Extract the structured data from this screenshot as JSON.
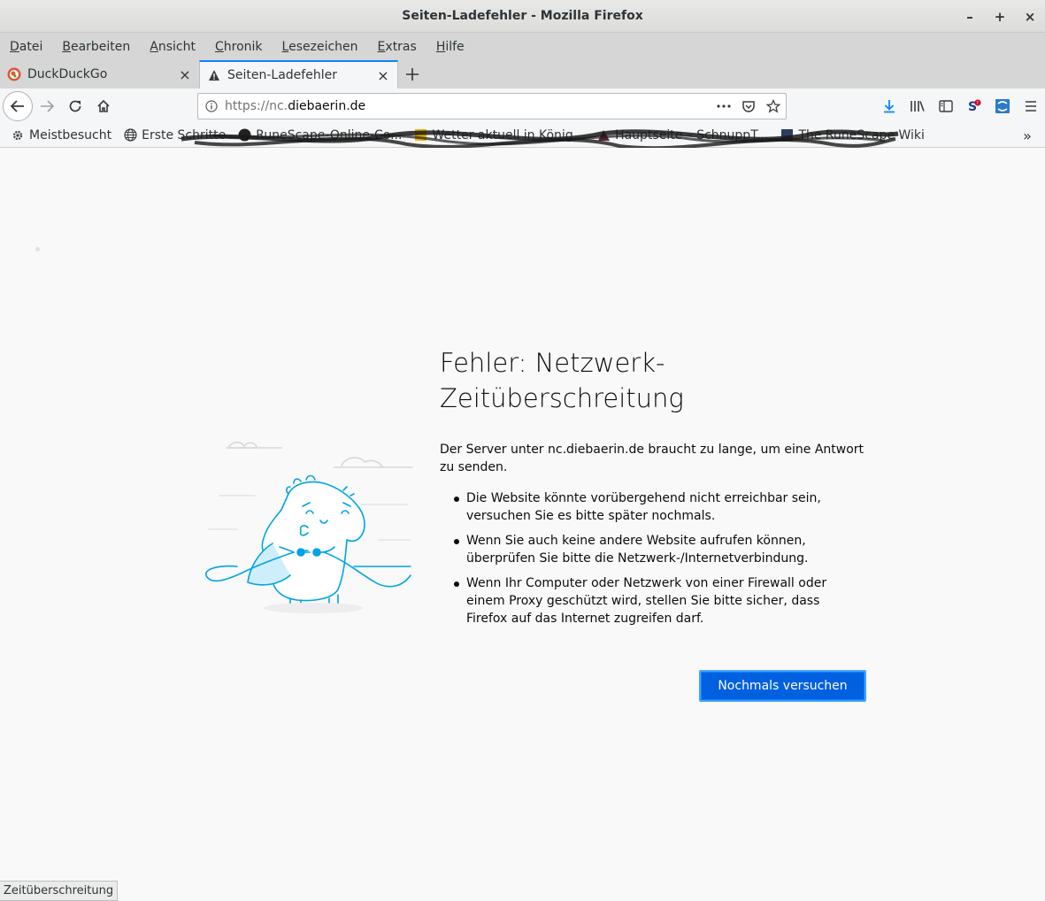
{
  "window": {
    "title": "Seiten-Ladefehler - Mozilla Firefox",
    "minimize": "–",
    "maximize": "+",
    "close": "×"
  },
  "menu": [
    {
      "pre": "",
      "acc": "D",
      "post": "atei"
    },
    {
      "pre": "",
      "acc": "B",
      "post": "earbeiten"
    },
    {
      "pre": "",
      "acc": "A",
      "post": "nsicht"
    },
    {
      "pre": "",
      "acc": "C",
      "post": "hronik"
    },
    {
      "pre": "",
      "acc": "L",
      "post": "esezeichen"
    },
    {
      "pre": "",
      "acc": "E",
      "post": "xtras"
    },
    {
      "pre": "",
      "acc": "H",
      "post": "ilfe"
    }
  ],
  "tabs": [
    {
      "label": "DuckDuckGo",
      "icon": "duckduckgo-icon"
    },
    {
      "label": "Seiten-Ladefehler",
      "icon": "warning-icon"
    }
  ],
  "url": {
    "scheme": "https://nc.",
    "domain": "diebaerin.de"
  },
  "bookmarks": [
    {
      "label": "Meistbesucht",
      "icon": "gear-icon"
    },
    {
      "label": "Erste Schritte",
      "icon": "globe-icon"
    },
    {
      "label": "RuneScape-Online-Co...",
      "icon": "runescape-icon"
    },
    {
      "label": "Wetter aktuell in König...",
      "icon": "weather-icon"
    },
    {
      "label": "Hauptseite – SchnuppT...",
      "icon": "site-icon"
    },
    {
      "label": "The RuneScape Wiki",
      "icon": "wiki-icon"
    }
  ],
  "error": {
    "title": "Fehler: Netzwerk-Zeitüberschreitung",
    "description": "Der Server unter nc.diebaerin.de braucht zu lange, um eine Antwort zu senden.",
    "items": [
      "Die Website könnte vorübergehend nicht erreichbar sein, versuchen Sie es bitte später nochmals.",
      "Wenn Sie auch keine andere Website aufrufen können, überprüfen Sie bitte die Netzwerk-/Internetverbindung.",
      "Wenn Ihr Computer oder Netzwerk von einer Firewall oder einem Proxy geschützt wird, stellen Sie bitte sicher, dass Firefox auf das Internet zugreifen darf."
    ],
    "retry_label": "Nochmals versuchen"
  },
  "status": "Zeitüberschreitung",
  "colors": {
    "accent": "#0a84ff",
    "button": "#0060df",
    "illustration": "#00a4e4"
  }
}
